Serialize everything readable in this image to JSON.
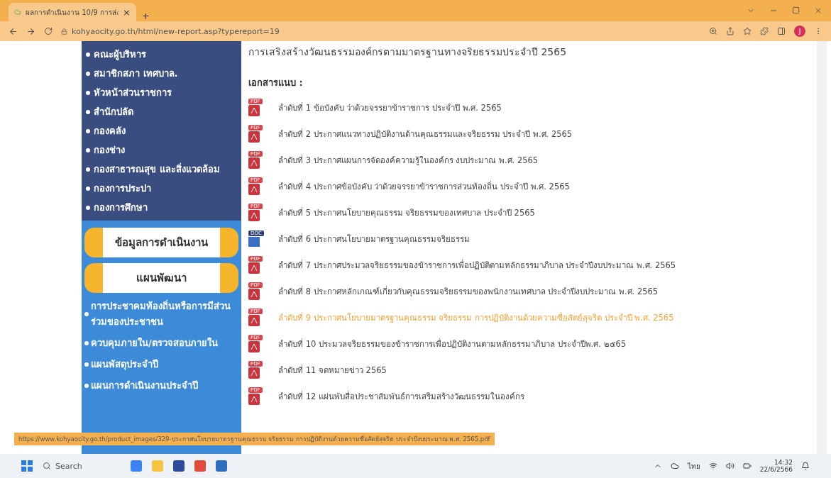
{
  "browser": {
    "tab_title": "ผลการดำเนินงาน 10/9 การส่ง",
    "tab_close": "×",
    "new_tab": "+",
    "url": "kohyaocity.go.th/html/new-report.asp?typereport=19",
    "profile_initial": "J"
  },
  "sidebar": {
    "menu_items": [
      "คณะผู้บริหาร",
      "สมาชิกสภา เทศบาล.",
      "หัวหน้าส่วนราชการ",
      "สำนักปลัด",
      "กองคลัง",
      "กองช่าง",
      "กองสาธารณสุข และสิ่งแวดล้อม",
      "กองการประปา",
      "กองการศึกษา"
    ],
    "banners": [
      "ข้อมูลการดำเนินงาน",
      "แผนพัฒนา"
    ],
    "links": [
      "การประชาคมท้องถิ่นหรือการมีส่วนร่วมของประชาชน",
      "ควบคุมภายใน/ตรวจสอบภายใน",
      "แผนพัสดุประจำปี",
      "แผนการดำเนินงานประจำปี"
    ]
  },
  "content": {
    "title": "การเสริงสร้างวัฒนธรรมองค์กรตามมาตรฐานทางจริยธรรมประจำปี 2565",
    "attachments_heading": "เอกสารแนบ :",
    "attachments": [
      {
        "kind": "pdf",
        "badge": "PDF",
        "text": "ลำดับที่ 1 ข้อบังคับ ว่าด้วยจรรยาข้าราชการ ประจำปี พ.ศ. 2565",
        "hovered": false
      },
      {
        "kind": "pdf",
        "badge": "PDF",
        "text": "ลำดับที่ 2 ประกาศแนวทางปฏิบัติงานด้านคุณธรรมและจริยธรรม ประจำปี พ.ศ. 2565",
        "hovered": false
      },
      {
        "kind": "pdf",
        "badge": "PDF",
        "text": "ลำดับที่ 3 ประกาศแผนการจัดองค์ความรู้ในองค์กร งบประมาณ พ.ศ. 2565",
        "hovered": false
      },
      {
        "kind": "pdf",
        "badge": "PDF",
        "text": "ลำดับที่ 4 ประกาศข้อบังคับ ว่าด้วยจรรยาข้าราชการส่วนท้องถิ่น ประจำปี พ.ศ. 2565",
        "hovered": false
      },
      {
        "kind": "pdf",
        "badge": "PDF",
        "text": "ลำดับที่ 5 ประกาศนโยบายคุณธรรม จริยธรรมของเทศบาล ประจำปี 2565",
        "hovered": false
      },
      {
        "kind": "doc",
        "badge": "DOC",
        "text": "ลำดับที่ 6 ประกาศนโยบายมาตรฐานคุณธรรมจริยธรรม",
        "hovered": false
      },
      {
        "kind": "pdf",
        "badge": "PDF",
        "text": "ลำดับที่ 7 ประกาศประมวลจริยธรรมของข้าราชการเพื่อปฏิบัติตามหลักธรรมาภิบาล ประจำปีงบประมาณ พ.ศ. 2565",
        "hovered": false
      },
      {
        "kind": "pdf",
        "badge": "PDF",
        "text": "ลำดับที่ 8 ประกาศหลักเกณฑ์เกี่ยวกับคุณธรรมจริยธรรมของพนักงานเทศบาล ประจำปีงบประมาณ พ.ศ. 2565",
        "hovered": false
      },
      {
        "kind": "pdf",
        "badge": "PDF",
        "text": "ลำดับที่ 9 ประกาศนโยบายมาตรฐานคุณธรรม จริยธรรม การปฏิบัติงานด้วยความซื่อสัตย์สุจริต ประจำปี พ.ศ. 2565",
        "hovered": true
      },
      {
        "kind": "pdf",
        "badge": "PDF",
        "text": "ลำดับที่ 10 ประมวลจริยธรรมของข้าราชการเพื่อปฏิบัติงานตามหลักธรรมาภิบาล ประจำปีพ.ศ. ๒๕65",
        "hovered": false
      },
      {
        "kind": "pdf",
        "badge": "PDF",
        "text": "ลำดับที่ 11 จดหมายข่าว 2565",
        "hovered": false
      },
      {
        "kind": "pdf",
        "badge": "PDF",
        "text": "ลำดับที่ 12 แผ่นพับสื่อประชาสัมพันธ์การเสริมสร้างวัฒนธรรมในองค์กร",
        "hovered": false
      }
    ]
  },
  "status_url": "https://www.kohyaocity.go.th/product_images/329-ประกาศนโยบายมาตรฐานคุณธรรม จริยธรรม การปฏิบัติงานด้วยความซื่อสัตย์สุจริต ประจำปีงบประมาณ พ.ศ. 2565.pdf",
  "taskbar": {
    "search_placeholder": "Search",
    "language": "ไทย",
    "time": "14:32",
    "date": "22/6/2566"
  }
}
